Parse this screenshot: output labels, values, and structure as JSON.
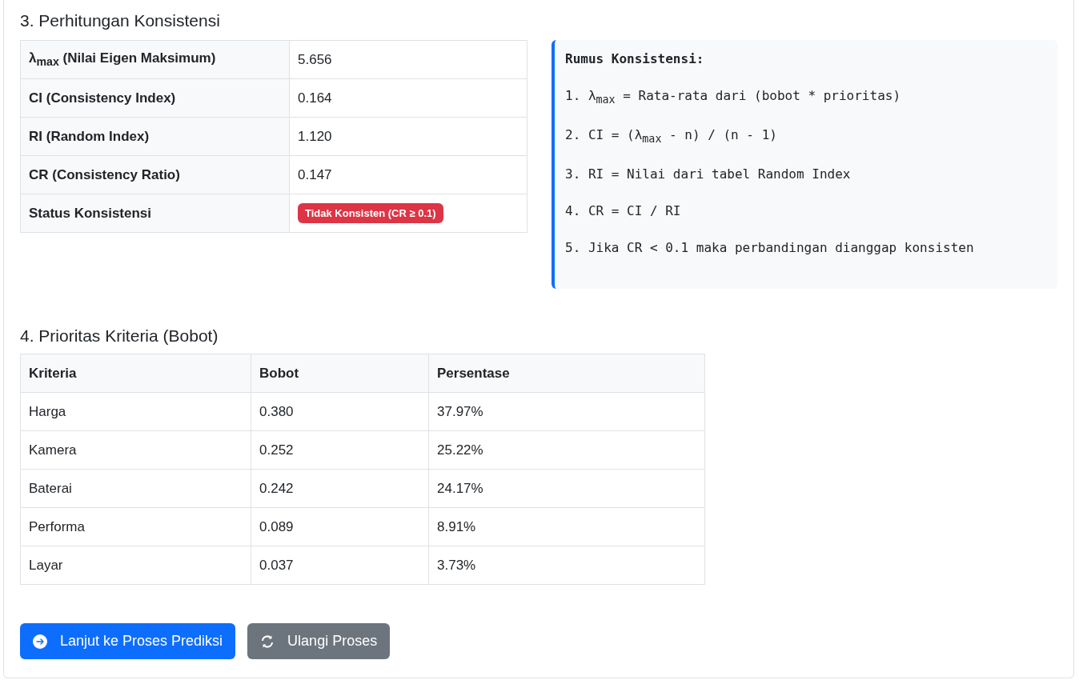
{
  "consistency": {
    "heading": "3. Perhitungan Konsistensi",
    "rows": [
      {
        "label": "λ$_{max}$ (Nilai Eigen Maksimum)",
        "kind": "text",
        "value": "5.656"
      },
      {
        "label": "CI (Consistency Index)",
        "kind": "text",
        "value": "0.164"
      },
      {
        "label": "RI (Random Index)",
        "kind": "text",
        "value": "1.120"
      },
      {
        "label": "CR (Consistency Ratio)",
        "kind": "text",
        "value": "0.147"
      },
      {
        "label": "Status Konsistensi",
        "kind": "badge",
        "value": "Tidak Konsisten (CR ≥ 0.1)",
        "color": "#dc3545"
      }
    ],
    "formula": {
      "title": "Rumus Konsistensi:",
      "lines": [
        "1. λ$_{max}$ = Rata-rata dari (bobot * prioritas)",
        "2. CI = (λ$_{max}$ - n) / (n - 1)",
        "3. RI = Nilai dari tabel Random Index",
        "4. CR = CI / RI",
        "5. Jika CR < 0.1 maka perbandingan dianggap konsisten"
      ]
    }
  },
  "priorities": {
    "heading": "4. Prioritas Kriteria (Bobot)",
    "columns": [
      "Kriteria",
      "Bobot",
      "Persentase"
    ],
    "rows": [
      [
        "Harga",
        "0.380",
        "37.97%"
      ],
      [
        "Kamera",
        "0.252",
        "25.22%"
      ],
      [
        "Baterai",
        "0.242",
        "24.17%"
      ],
      [
        "Performa",
        "0.089",
        "8.91%"
      ],
      [
        "Layar",
        "0.037",
        "3.73%"
      ]
    ]
  },
  "buttons": [
    {
      "label": "Lanjut ke Proses Prediksi",
      "kind": "primary"
    },
    {
      "label": "Ulangi Proses",
      "kind": "secondary"
    }
  ]
}
